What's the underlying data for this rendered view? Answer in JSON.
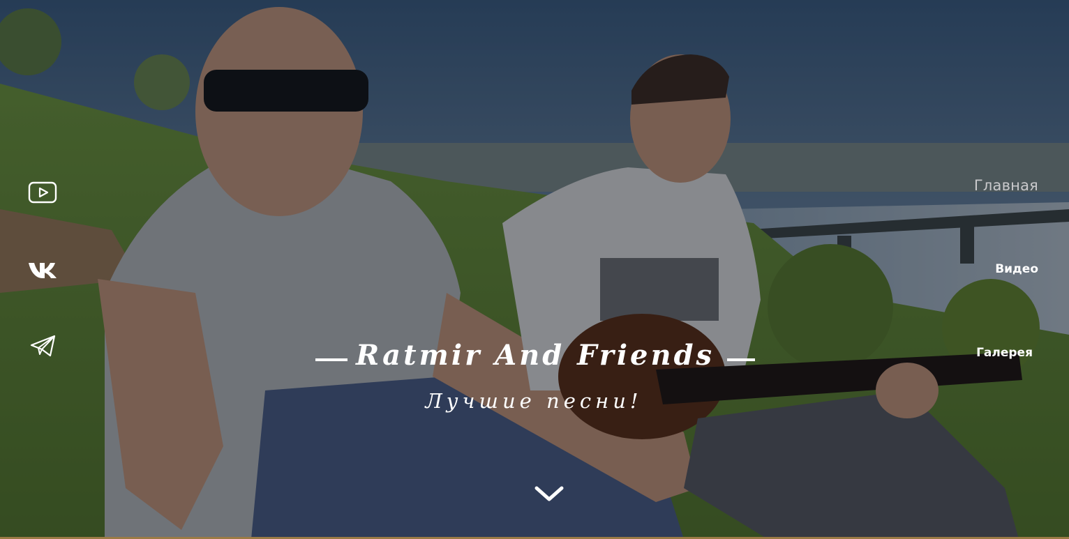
{
  "social": [
    {
      "icon": "youtube-icon"
    },
    {
      "icon": "vk-icon"
    },
    {
      "icon": "telegram-icon"
    }
  ],
  "nav": {
    "items": [
      {
        "label": "Главная",
        "state": "active"
      },
      {
        "label": "Видео"
      },
      {
        "label": "Галерея"
      }
    ]
  },
  "hero": {
    "title": "Ratmir And Friends",
    "subtitle": "Лучшие песни!",
    "scroll_icon": "chevron-down-icon"
  },
  "colors": {
    "text": "#ffffff",
    "nav_active": "#c9c9cc",
    "overlay": "#0a0c12",
    "accent_strip": "#9c7b45"
  }
}
